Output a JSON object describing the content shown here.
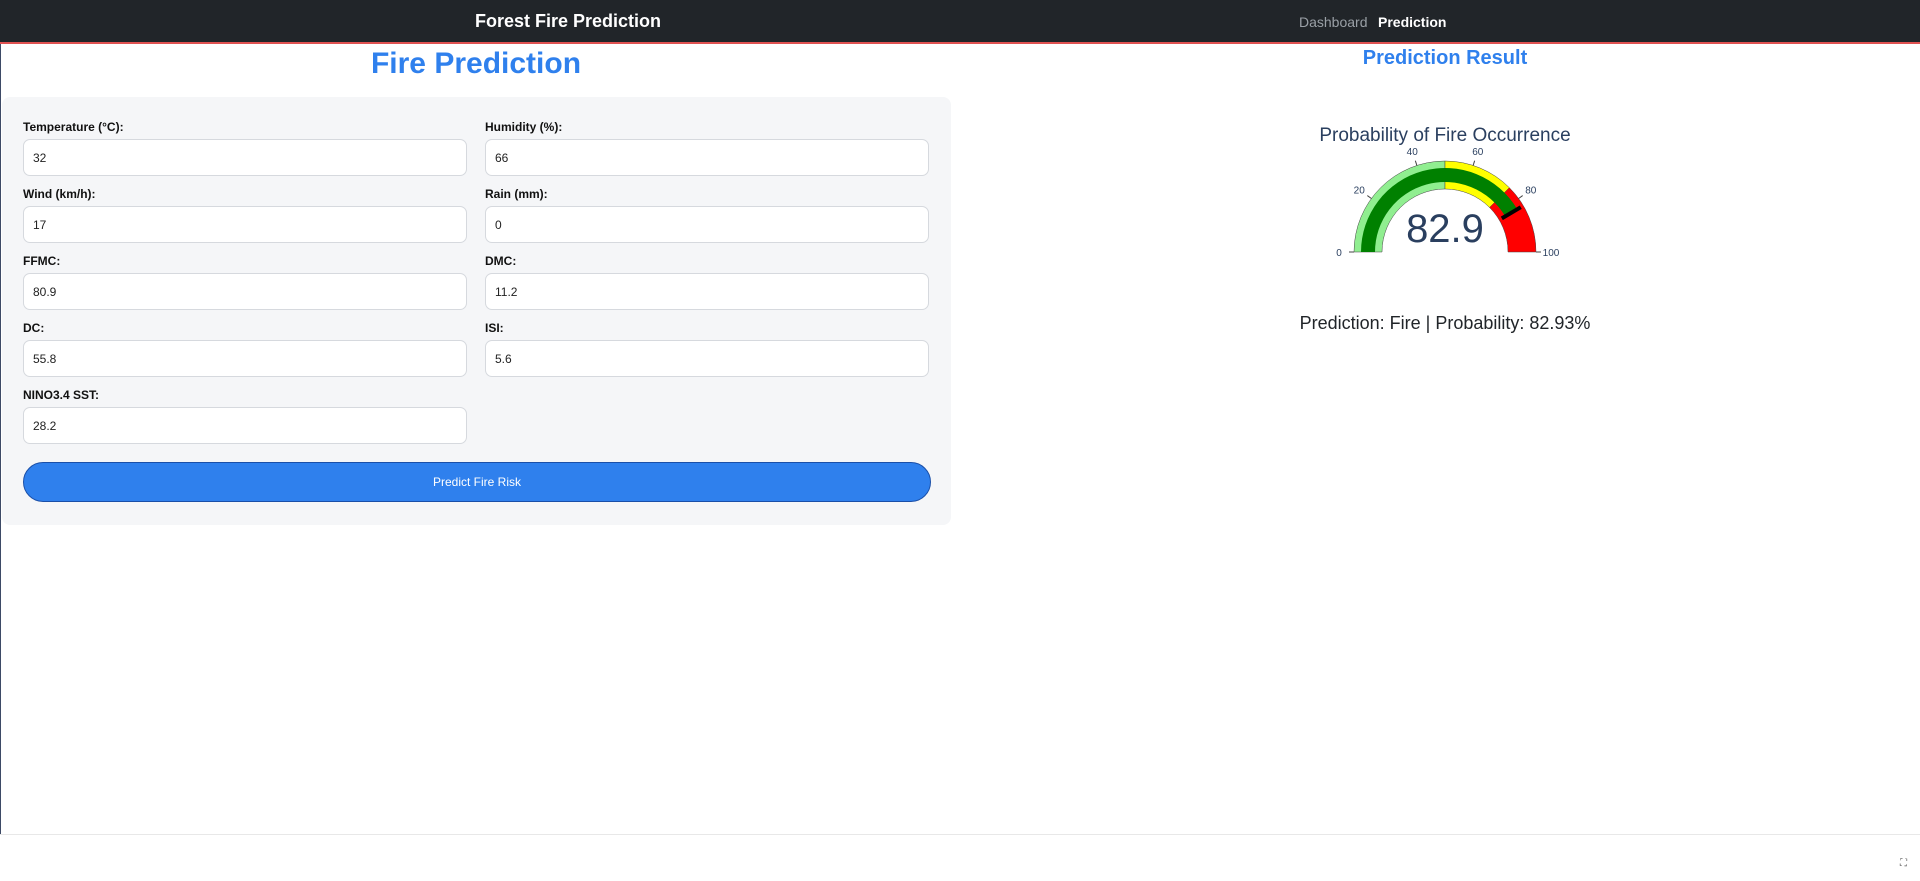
{
  "navbar": {
    "brand": "Forest Fire Prediction",
    "links": [
      {
        "label": "Dashboard",
        "active": false
      },
      {
        "label": "Prediction",
        "active": true
      }
    ]
  },
  "form": {
    "title": "Fire Prediction",
    "fields": {
      "temperature": {
        "label": "Temperature (°C):",
        "value": "32"
      },
      "humidity": {
        "label": "Humidity (%):",
        "value": "66"
      },
      "wind": {
        "label": "Wind (km/h):",
        "value": "17"
      },
      "rain": {
        "label": "Rain (mm):",
        "value": "0"
      },
      "ffmc": {
        "label": "FFMC:",
        "value": "80.9"
      },
      "dmc": {
        "label": "DMC:",
        "value": "11.2"
      },
      "dc": {
        "label": "DC:",
        "value": "55.8"
      },
      "isi": {
        "label": "ISI:",
        "value": "5.6"
      },
      "nino": {
        "label": "NINO3.4 SST:",
        "value": "28.2"
      }
    },
    "submit_label": "Predict Fire Risk"
  },
  "result": {
    "title": "Prediction Result",
    "text": "Prediction: Fire | Probability: 82.93%"
  },
  "chart_data": {
    "type": "gauge",
    "title": "Probability of Fire Occurrence",
    "value": 82.93,
    "value_label": "82.9",
    "range": [
      0,
      100
    ],
    "ticks": [
      "0",
      "20",
      "40",
      "60",
      "80",
      "100"
    ],
    "steps": [
      {
        "range": [
          0,
          50
        ],
        "color": "#90ee90"
      },
      {
        "range": [
          50,
          75
        ],
        "color": "#ffff00"
      },
      {
        "range": [
          75,
          100
        ],
        "color": "#ff0000"
      }
    ],
    "bar_color": "#008000",
    "threshold": {
      "value": 83,
      "color": "#000000"
    }
  },
  "icons": {
    "corner": "fullscreen-toggle-icon"
  }
}
